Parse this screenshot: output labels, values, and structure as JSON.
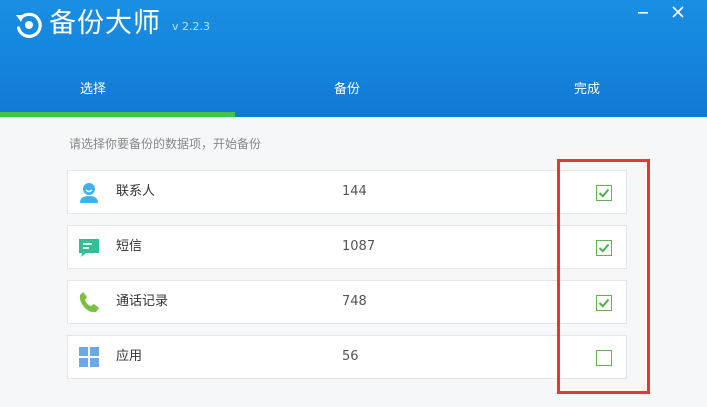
{
  "app": {
    "title": "备份大师",
    "version": "v 2.2.3",
    "icons": {
      "logo": "backup-restore-icon",
      "minimize": "minimize-icon",
      "close": "close-icon"
    },
    "colors": {
      "header": "#1485dd",
      "accent": "#44c24a",
      "highlight": "#e0393b"
    }
  },
  "tabs": [
    {
      "label": "选择",
      "active": true
    },
    {
      "label": "备份",
      "active": false
    },
    {
      "label": "完成",
      "active": false
    }
  ],
  "hint": "请选择你要备份的数据项，开始备份",
  "items": [
    {
      "icon": "contact-icon",
      "label": "联系人",
      "count": "144",
      "checked": true
    },
    {
      "icon": "message-icon",
      "label": "短信",
      "count": "1087",
      "checked": true
    },
    {
      "icon": "phone-icon",
      "label": "通话记录",
      "count": "748",
      "checked": true
    },
    {
      "icon": "apps-grid-icon",
      "label": "应用",
      "count": "56",
      "checked": false
    }
  ]
}
